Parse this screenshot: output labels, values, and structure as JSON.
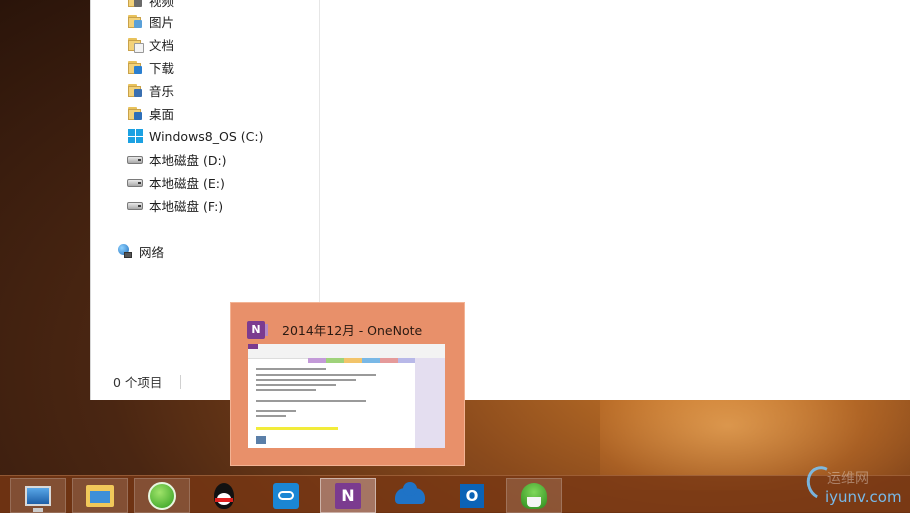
{
  "explorer": {
    "nav": {
      "items": [
        {
          "label": "视频",
          "icon": "video-folder-icon"
        },
        {
          "label": "图片",
          "icon": "pictures-folder-icon"
        },
        {
          "label": "文档",
          "icon": "documents-folder-icon"
        },
        {
          "label": "下载",
          "icon": "downloads-folder-icon"
        },
        {
          "label": "音乐",
          "icon": "music-folder-icon"
        },
        {
          "label": "桌面",
          "icon": "desktop-folder-icon"
        },
        {
          "label": "Windows8_OS (C:)",
          "icon": "windows-drive-icon"
        },
        {
          "label": "本地磁盘 (D:)",
          "icon": "drive-icon"
        },
        {
          "label": "本地磁盘 (E:)",
          "icon": "drive-icon"
        },
        {
          "label": "本地磁盘 (F:)",
          "icon": "drive-icon"
        }
      ],
      "network": {
        "label": "网络",
        "icon": "network-icon"
      }
    },
    "status": {
      "item_count": "0 个项目"
    }
  },
  "preview": {
    "title": "2014年12月 - OneNote",
    "app_icon": "onenote-icon",
    "app_icon_letter": "N"
  },
  "taskbar": {
    "buttons": [
      {
        "name": "remote-desktop",
        "icon": "remote-desktop-icon"
      },
      {
        "name": "file-explorer",
        "icon": "file-explorer-icon"
      },
      {
        "name": "green-browser",
        "icon": "refresh-browser-icon"
      },
      {
        "name": "qq",
        "icon": "qq-penguin-icon"
      },
      {
        "name": "cloud-sync",
        "icon": "cloud-sync-icon"
      },
      {
        "name": "onenote",
        "icon": "onenote-icon",
        "letter": "N"
      },
      {
        "name": "onedrive",
        "icon": "onedrive-cloud-icon"
      },
      {
        "name": "outlook",
        "icon": "outlook-icon",
        "letter": "O"
      },
      {
        "name": "mushroom-app",
        "icon": "mushroom-icon"
      }
    ]
  },
  "watermark": {
    "cn": "运维网",
    "en": "iyunv.com"
  }
}
